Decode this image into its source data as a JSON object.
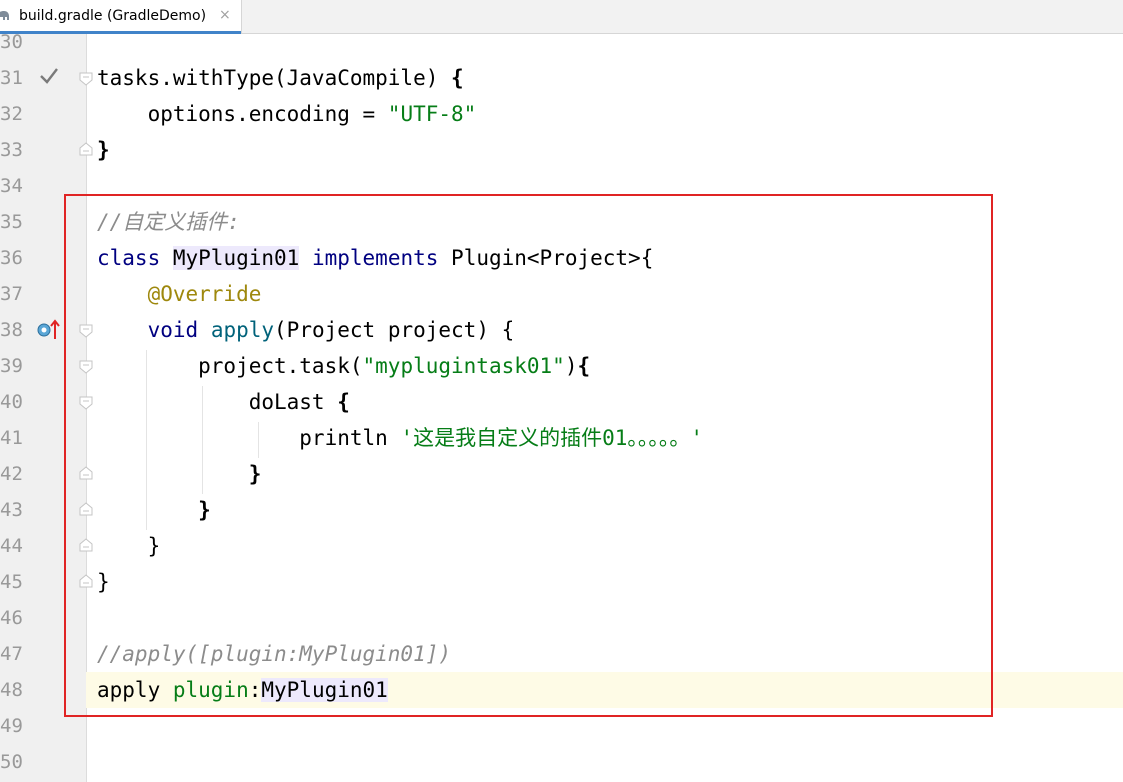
{
  "tab": {
    "title": "build.gradle (GradleDemo)",
    "close_glyph": "×",
    "icon": "gradle-elephant-icon"
  },
  "gutter_icons": {
    "line31": "checkmark-icon",
    "line38": "implements-method-icon"
  },
  "colors": {
    "keyword": "#000080",
    "string": "#067d17",
    "comment": "#8c8c8c",
    "annotation": "#9e880d",
    "method": "#00627a",
    "highlight_box": "#e02424",
    "current_line": "#fefbe6"
  },
  "lines": [
    {
      "n": "30"
    },
    {
      "n": "31",
      "c": [
        "tasks.withType(JavaCompile) ",
        "{"
      ]
    },
    {
      "n": "32",
      "c": [
        "    options.encoding = ",
        "\"UTF-8\""
      ]
    },
    {
      "n": "33",
      "c": [
        "}"
      ]
    },
    {
      "n": "34"
    },
    {
      "n": "35",
      "c": [
        "//自定义插件:"
      ]
    },
    {
      "n": "36",
      "c": [
        "class",
        " ",
        "MyPlugin01",
        " ",
        "implements",
        " Plugin<Project>{"
      ]
    },
    {
      "n": "37",
      "c": [
        "    ",
        "@Override"
      ]
    },
    {
      "n": "38",
      "c": [
        "    ",
        "void",
        " ",
        "apply",
        "(Project project) {"
      ]
    },
    {
      "n": "39",
      "c": [
        "        project.task(",
        "\"myplugintask01\"",
        ")",
        "{"
      ]
    },
    {
      "n": "40",
      "c": [
        "            doLast ",
        "{"
      ]
    },
    {
      "n": "41",
      "c": [
        "                println ",
        "'这是我自定义的插件01。。。。。'"
      ]
    },
    {
      "n": "42",
      "c": [
        "            ",
        "}"
      ]
    },
    {
      "n": "43",
      "c": [
        "        ",
        "}"
      ]
    },
    {
      "n": "44",
      "c": [
        "    }"
      ]
    },
    {
      "n": "45",
      "c": [
        "}"
      ]
    },
    {
      "n": "46"
    },
    {
      "n": "47",
      "c": [
        "//apply([plugin:MyPlugin01])"
      ]
    },
    {
      "n": "48",
      "c": [
        "apply ",
        "plugin",
        ":",
        "MyPlugin01"
      ]
    },
    {
      "n": "49"
    },
    {
      "n": "50"
    }
  ]
}
